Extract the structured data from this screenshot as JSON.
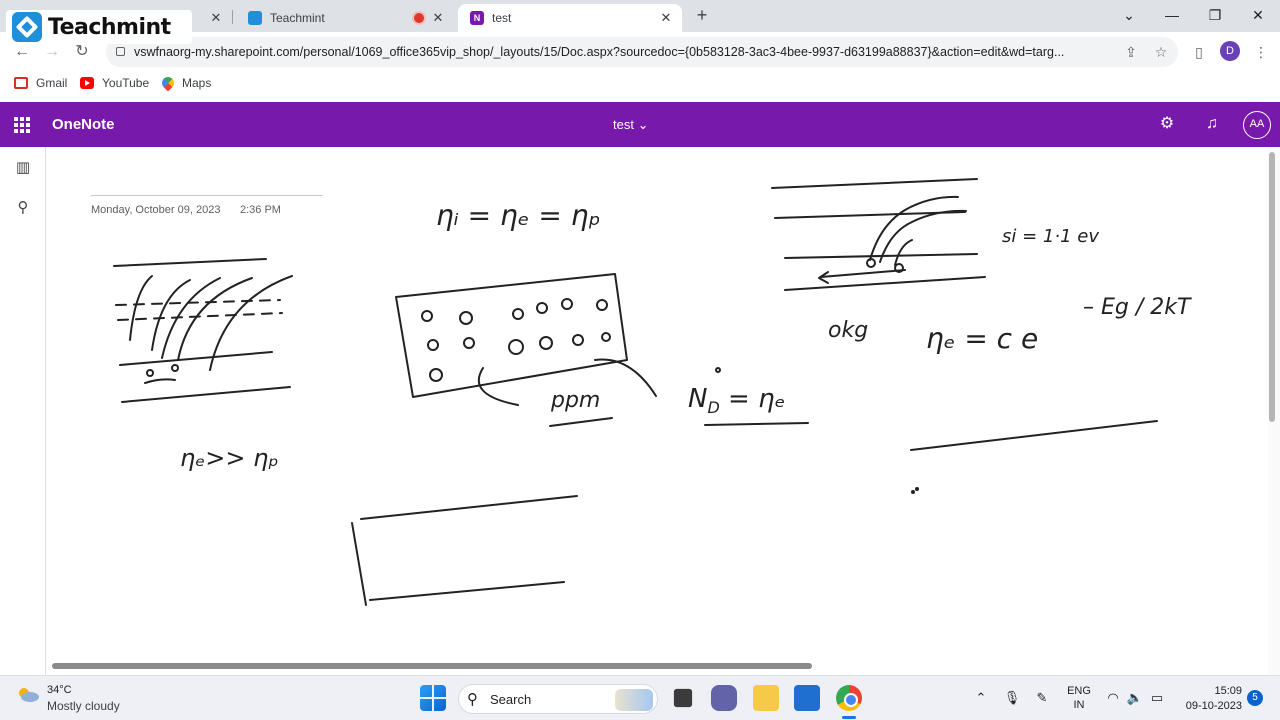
{
  "browser": {
    "logo_text": "Teachmint",
    "tabs": [
      {
        "label": "Teachmint",
        "close": "✕"
      },
      {
        "label": "test",
        "close": "✕"
      }
    ],
    "new_tab": "+",
    "window_controls": {
      "dropdown": "⌄",
      "minimize": "—",
      "maximize": "❐",
      "close": "✕"
    },
    "url": "vswfnaorg-my.sharepoint.com/personal/1069_office365vip_shop/_layouts/15/Doc.aspx?sourcedoc={0b583128-3ac3-4bee-9937-d63199a88837}&action=edit&wd=targ...",
    "profile_initial": "D",
    "bookmarks": [
      "Gmail",
      "YouTube",
      "Maps"
    ]
  },
  "onenote": {
    "app_name": "OneNote",
    "doc_title": "test ⌄",
    "user_initials": "AA",
    "page_date": "Monday, October 09, 2023",
    "page_time": "2:36 PM"
  },
  "taskbar": {
    "temperature": "34°C",
    "weather": "Mostly cloudy",
    "search_label": "Search",
    "lang_line1": "ENG",
    "lang_line2": "IN",
    "time": "15:09",
    "date": "09-10-2023",
    "notifications": "5"
  },
  "colors": {
    "onenote_purple": "#7719aa",
    "chrome_tabstrip": "#dee1e6",
    "taskbar": "#eef0f5"
  },
  "icons": [
    "search-icon",
    "gear-icon",
    "bell-icon",
    "library-icon",
    "star-icon",
    "share-icon",
    "sidebar-icon",
    "menu-dots-icon",
    "mic-icon",
    "wifi-icon",
    "speaker-icon",
    "battery-icon",
    "chevron-up-icon",
    "pen-icon"
  ]
}
